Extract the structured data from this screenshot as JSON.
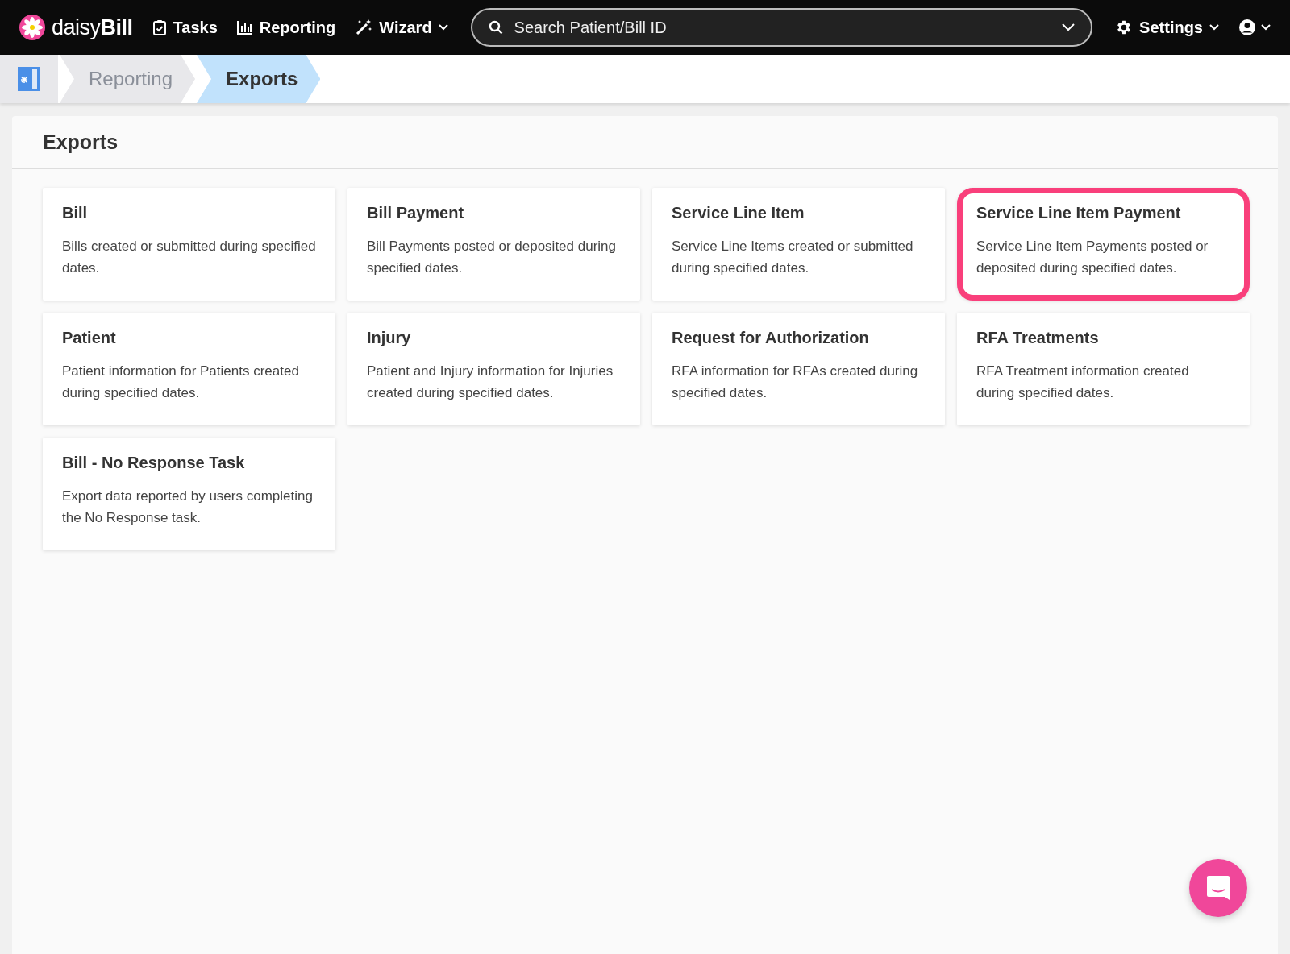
{
  "nav": {
    "logo": "daisy**Bill**",
    "items": [
      {
        "kind": "tasks",
        "label": "Tasks",
        "dropdown": false
      },
      {
        "kind": "reporting",
        "label": "Reporting",
        "dropdown": false
      },
      {
        "kind": "wizard",
        "label": "Wizard",
        "dropdown": true
      }
    ],
    "search": {
      "placeholder": "Search Patient/Bill ID"
    },
    "settings": {
      "label": "Settings"
    }
  },
  "breadcrumb": [
    {
      "label": "Reporting",
      "selected": false
    },
    {
      "label": "Exports",
      "selected": true
    }
  ],
  "panel": {
    "title": "Exports",
    "cards": [
      {
        "title": "Bill",
        "description": "Bills created or submitted during specified dates.",
        "highlighted": false
      },
      {
        "title": "Bill Payment",
        "description": "Bill Payments posted or deposited during specified dates.",
        "highlighted": false
      },
      {
        "title": "Service Line Item",
        "description": "Service Line Items created or submitted during specified dates.",
        "highlighted": false
      },
      {
        "title": "Service Line Item Payment",
        "description": "Service Line Item Payments posted or deposited during specified dates.",
        "highlighted": true
      },
      {
        "title": "Patient",
        "description": "Patient information for Patients created during specified dates.",
        "highlighted": false
      },
      {
        "title": "Injury",
        "description": "Patient and Injury information for Injuries created during specified dates.",
        "highlighted": false
      },
      {
        "title": "Request for Authorization",
        "description": "RFA information for RFAs created during specified dates.",
        "highlighted": false
      },
      {
        "title": "RFA Treatments",
        "description": "RFA Treatment information created during specified dates.",
        "highlighted": false
      },
      {
        "title": "Bill - No Response Task",
        "description": "Export data reported by users completing the No Response task.",
        "highlighted": false
      }
    ]
  }
}
